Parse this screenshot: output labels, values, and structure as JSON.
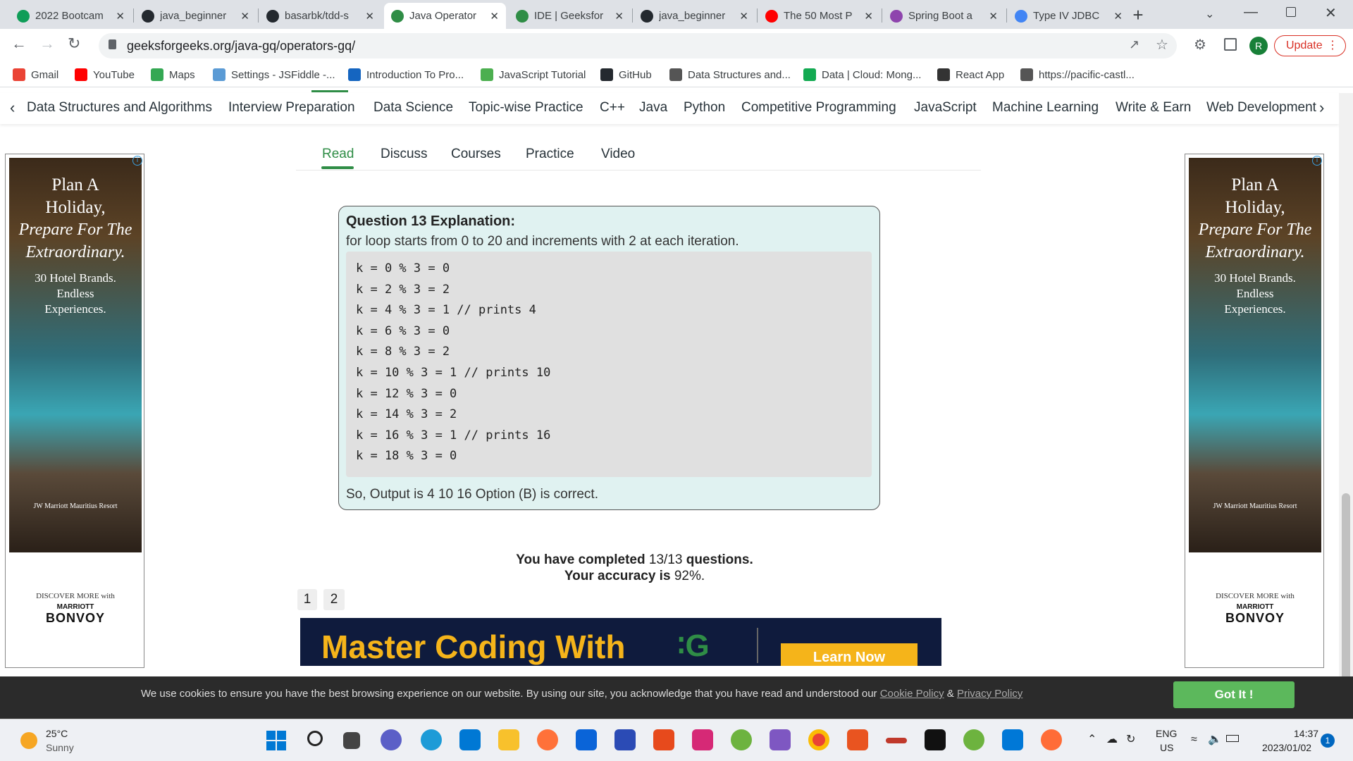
{
  "browser": {
    "tabs": [
      {
        "label": "2022 Bootcam",
        "color": "#0f9d58",
        "active": false
      },
      {
        "label": "java_beginner",
        "color": "#24292f",
        "active": false
      },
      {
        "label": "basarbk/tdd-s",
        "color": "#24292f",
        "active": false
      },
      {
        "label": "Java Operator",
        "color": "#2f8d46",
        "active": true
      },
      {
        "label": "IDE | Geeksfor",
        "color": "#2f8d46",
        "active": false
      },
      {
        "label": "java_beginner",
        "color": "#24292f",
        "active": false
      },
      {
        "label": "The 50 Most P",
        "color": "#ff0000",
        "active": false
      },
      {
        "label": "Spring Boot a",
        "color": "#8e44ad",
        "active": false
      },
      {
        "label": "Type IV JDBC",
        "color": "#4285f4",
        "active": false
      }
    ],
    "tab_close": "✕",
    "new_tab": "+",
    "url": "geeksforgeeks.org/java-gq/operators-gq/",
    "profile_initial": "R",
    "update_label": "Update",
    "bookmarks": [
      {
        "label": "Gmail",
        "color": "#ea4335"
      },
      {
        "label": "YouTube",
        "color": "#ff0000"
      },
      {
        "label": "Maps",
        "color": "#34a853"
      },
      {
        "label": "Settings - JSFiddle -...",
        "color": "#5b9bd5"
      },
      {
        "label": "Introduction To Pro...",
        "color": "#1565c0"
      },
      {
        "label": "JavaScript Tutorial",
        "color": "#4caf50"
      },
      {
        "label": "GitHub",
        "color": "#24292f"
      },
      {
        "label": "Data Structures and...",
        "color": "#555555"
      },
      {
        "label": "Data | Cloud: Mong...",
        "color": "#13aa52"
      },
      {
        "label": "React App",
        "color": "#333333"
      },
      {
        "label": "https://pacific-castl...",
        "color": "#555555"
      }
    ]
  },
  "site_nav": {
    "items": [
      "Data Structures and Algorithms",
      "Interview Preparation",
      "Data Science",
      "Topic-wise Practice",
      "C++",
      "Java",
      "Python",
      "Competitive Programming",
      "JavaScript",
      "Machine Learning",
      "Write & Earn",
      "Web Development"
    ]
  },
  "article_tabs": [
    "Read",
    "Discuss",
    "Courses",
    "Practice",
    "Video"
  ],
  "explanation": {
    "title": "Question 13 Explanation:",
    "intro": "for loop starts from 0 to 20 and increments with 2 at each iteration.",
    "code_lines": [
      "k = 0 % 3 = 0",
      "k = 2 % 3 = 2",
      "k = 4 % 3 = 1 // prints 4",
      "k = 6 % 3 = 0",
      "k = 8 % 3 = 2",
      "k = 10 % 3 = 1 // prints 10",
      "k = 12 % 3 = 0",
      "k = 14 % 3 = 2",
      "k = 16 % 3 = 1 // prints 16",
      "k = 18 % 3 = 0"
    ],
    "conclusion": "So, Output is 4 10 16 Option (B) is correct."
  },
  "results": {
    "completed_prefix": "You have completed",
    "completed_value": "13/13",
    "completed_suffix": "questions.",
    "accuracy_prefix": "Your accuracy is",
    "accuracy_value": "92%."
  },
  "pagination": [
    "1",
    "2"
  ],
  "banner": {
    "headline": "Master Coding With",
    "cta": "Learn Now"
  },
  "ad": {
    "title_line1": "Plan A",
    "title_line2": "Holiday,",
    "title_line3": "Prepare For The",
    "title_line4": "Extraordinary.",
    "sub_line1": "30 Hotel Brands.",
    "sub_line2": "Endless",
    "sub_line3": "Experiences.",
    "caption": "JW Marriott Mauritius Resort",
    "discover": "DISCOVER MORE with",
    "brand_small": "MARRIOTT",
    "brand": "BONVOY"
  },
  "cookie": {
    "text": "We use cookies to ensure you have the best browsing experience on our website. By using our site, you acknowledge that you have read and understood our",
    "cookie_link": "Cookie Policy",
    "amp": "&",
    "privacy_link": "Privacy Policy",
    "button": "Got It !"
  },
  "taskbar": {
    "weather_temp": "25°C",
    "weather_desc": "Sunny",
    "lang": "ENG",
    "region": "US",
    "time": "14:37",
    "date": "2023/01/02",
    "notification_count": "1"
  }
}
